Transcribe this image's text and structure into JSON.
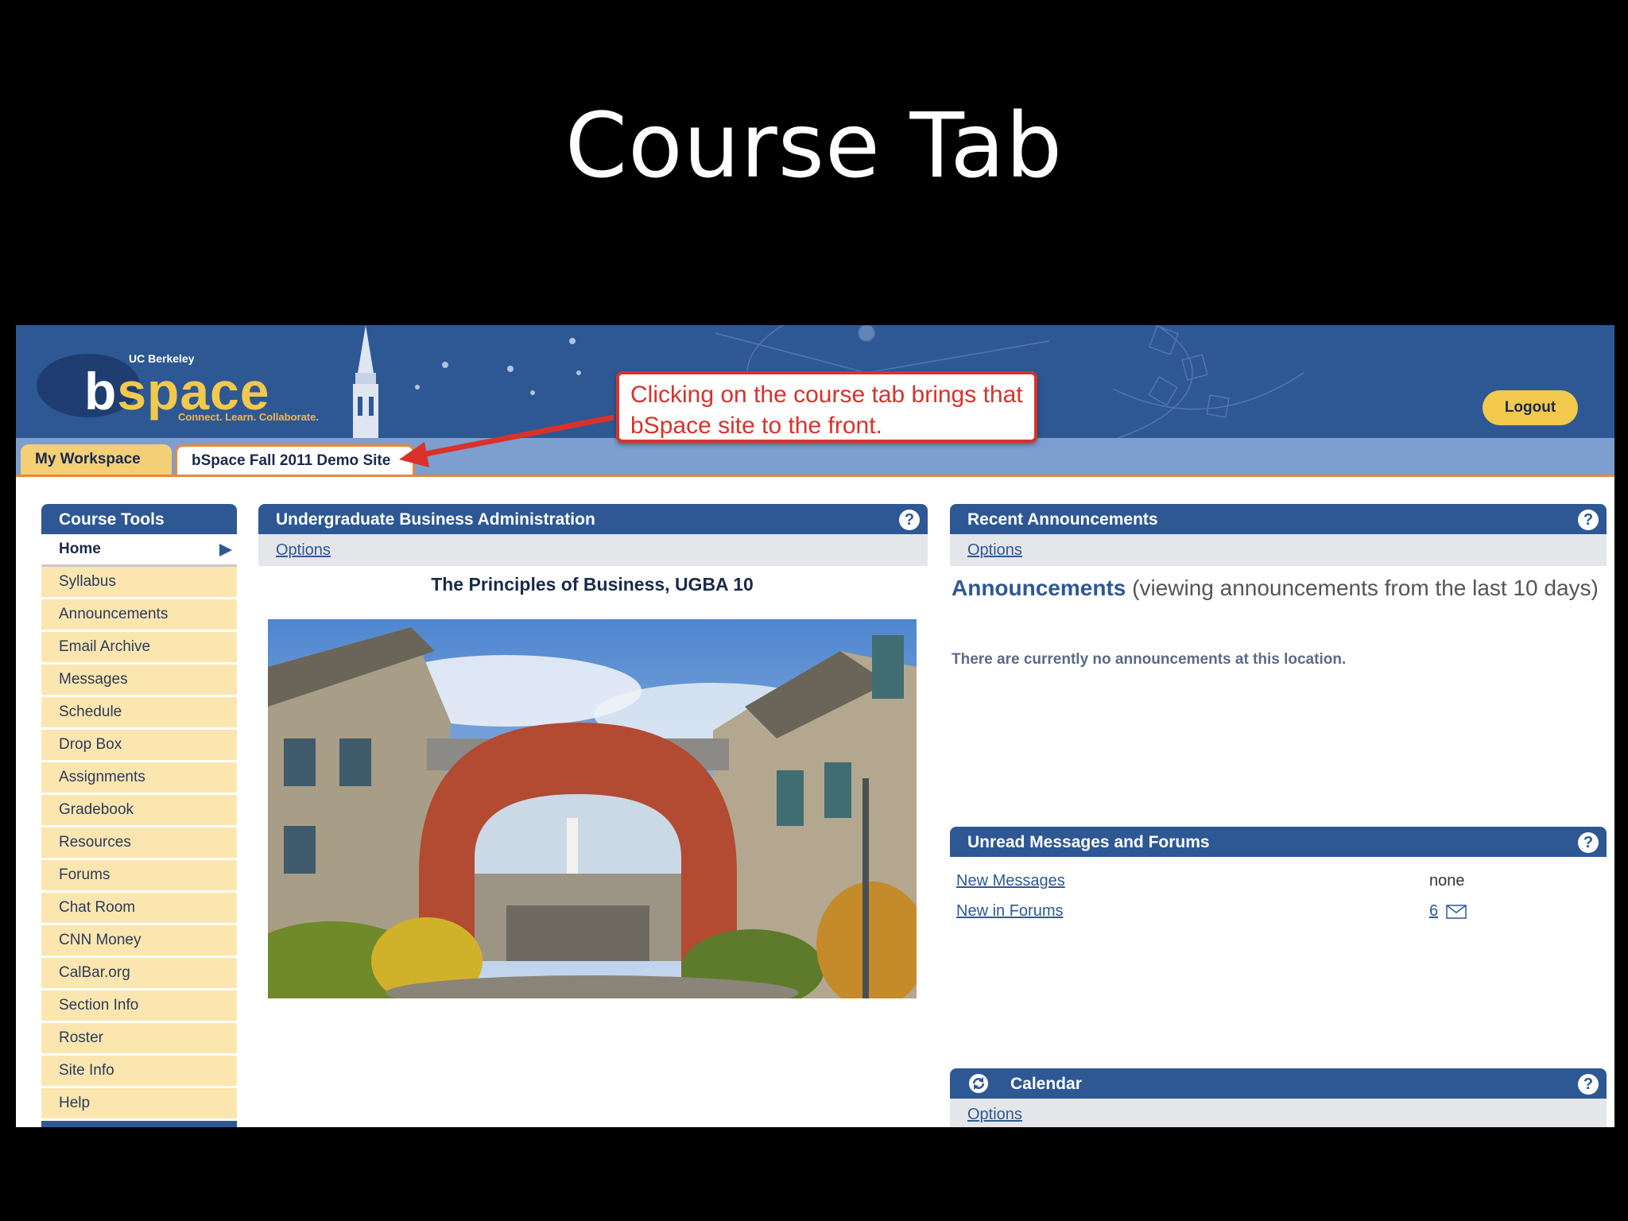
{
  "slide": {
    "title": "Course Tab"
  },
  "banner": {
    "logo_org": "UC Berkeley",
    "logo_b": "b",
    "logo_rest": "space",
    "logo_tagline": "Connect. Learn. Collaborate.",
    "logout_label": "Logout"
  },
  "callout": {
    "text": "Clicking on the course tab brings that bSpace site to the front."
  },
  "tabs": [
    {
      "label": "My Workspace"
    },
    {
      "label": "bSpace Fall 2011 Demo Site"
    }
  ],
  "nav": {
    "header": "Course Tools",
    "items": [
      {
        "label": "Home",
        "active": true
      },
      {
        "label": "Syllabus"
      },
      {
        "label": "Announcements"
      },
      {
        "label": "Email Archive"
      },
      {
        "label": "Messages"
      },
      {
        "label": "Schedule"
      },
      {
        "label": "Drop Box"
      },
      {
        "label": "Assignments"
      },
      {
        "label": "Gradebook"
      },
      {
        "label": "Resources"
      },
      {
        "label": "Forums"
      },
      {
        "label": "Chat Room"
      },
      {
        "label": "CNN Money"
      },
      {
        "label": "CalBar.org"
      },
      {
        "label": "Section Info"
      },
      {
        "label": "Roster"
      },
      {
        "label": "Site Info"
      },
      {
        "label": "Help"
      }
    ]
  },
  "main": {
    "header": "Undergraduate Business Administration",
    "options": "Options",
    "course_name": "The Principles of Business, UGBA 10",
    "help": "?"
  },
  "announcements": {
    "header": "Recent Announcements",
    "options": "Options",
    "title_strong": "Announcements",
    "title_rest": " (viewing announcements from the last 10 days)",
    "empty": "There are currently no announcements at this location.",
    "help": "?"
  },
  "unread": {
    "header": "Unread Messages and Forums",
    "help": "?",
    "rows": [
      {
        "label": "New Messages",
        "value": "none"
      },
      {
        "label": "New in Forums",
        "value": "6"
      }
    ]
  },
  "calendar": {
    "header": "Calendar",
    "options": "Options",
    "help": "?"
  },
  "colors": {
    "brand_blue": "#2e5894",
    "gold": "#f2c94c",
    "callout_red": "#d8322a",
    "nav_bg": "#fce6b0"
  }
}
